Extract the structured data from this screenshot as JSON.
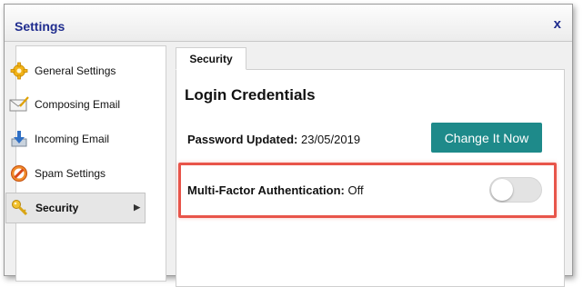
{
  "window": {
    "title": "Settings",
    "close_label": "x"
  },
  "sidebar": {
    "items": [
      {
        "label": "General Settings",
        "icon": "gear-icon",
        "active": false
      },
      {
        "label": "Composing Email",
        "icon": "envelope-pen-icon",
        "active": false
      },
      {
        "label": "Incoming Email",
        "icon": "download-arrow-icon",
        "active": false
      },
      {
        "label": "Spam Settings",
        "icon": "no-entry-icon",
        "active": false
      },
      {
        "label": "Security",
        "icon": "key-icon",
        "active": true
      }
    ]
  },
  "tabs": [
    {
      "label": "Security",
      "active": true
    }
  ],
  "security": {
    "heading": "Login Credentials",
    "password_label": "Password Updated:",
    "password_value": "23/05/2019",
    "change_button": "Change It Now",
    "mfa_label": "Multi-Factor Authentication:",
    "mfa_value": "Off",
    "mfa_enabled": false
  },
  "colors": {
    "title_text": "#1f2c8e",
    "button_bg": "#1e8a8a",
    "highlight": "#e8554a"
  }
}
